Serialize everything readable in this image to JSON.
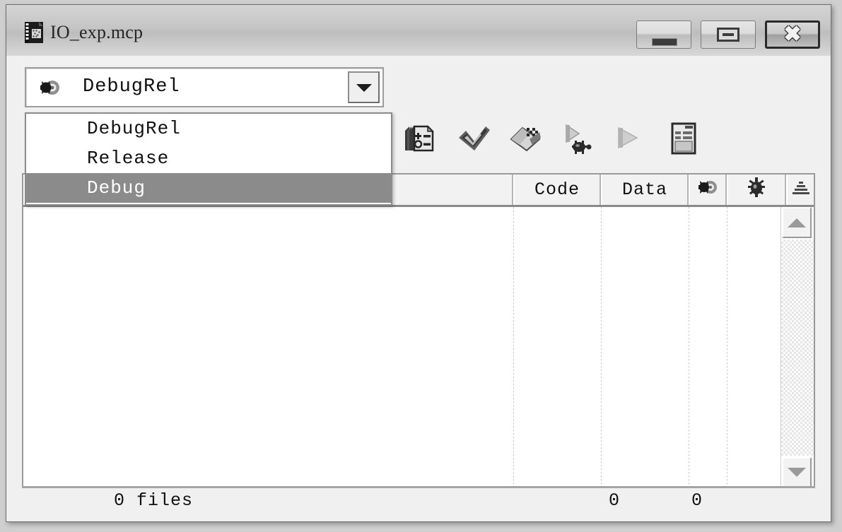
{
  "window": {
    "title": "IO_exp.mcp",
    "title_icon": "project-file-icon",
    "controls": [
      {
        "name": "minimize-button",
        "label": "–",
        "glyph": "minimize-icon"
      },
      {
        "name": "maximize-button",
        "label": "□",
        "glyph": "maximize-icon"
      },
      {
        "name": "close-button",
        "label": "✖",
        "glyph": "close-icon"
      }
    ]
  },
  "target_combo": {
    "icon": "build-target-icon",
    "value": "DebugRel",
    "expanded": true,
    "options": [
      {
        "label": "DebugRel",
        "selected": false
      },
      {
        "label": "Release",
        "selected": false
      },
      {
        "label": "Debug",
        "selected": true
      }
    ]
  },
  "toolbar": {
    "buttons": [
      {
        "name": "target-settings-button",
        "icon": "settings-list-icon",
        "enabled": true
      },
      {
        "name": "compile-button",
        "icon": "checkmark-icon",
        "enabled": true
      },
      {
        "name": "make-button",
        "icon": "make-build-icon",
        "enabled": true
      },
      {
        "name": "debug-button",
        "icon": "debug-bug-icon",
        "enabled": true
      },
      {
        "name": "run-button",
        "icon": "run-play-icon",
        "enabled": false
      },
      {
        "name": "project-inspector-button",
        "icon": "document-report-icon",
        "enabled": true
      }
    ]
  },
  "file_list": {
    "columns": [
      {
        "key": "file",
        "label": "",
        "icon": ""
      },
      {
        "key": "code",
        "label": "Code",
        "icon": ""
      },
      {
        "key": "data",
        "label": "Data",
        "icon": ""
      },
      {
        "key": "target",
        "label": "",
        "icon": "target-icon"
      },
      {
        "key": "debug",
        "label": "",
        "icon": "bug-icon"
      },
      {
        "key": "sort",
        "label": "",
        "icon": "sort-pyramid-icon"
      }
    ],
    "rows": []
  },
  "scrollbar": {
    "up_label": "▲",
    "down_label": "▼"
  },
  "status_bar": {
    "files": "0 files",
    "code_total": "0",
    "data_total": "0",
    "resize_grip": "resize-grip-icon"
  },
  "colors": {
    "window_bg": "#f0f0f0",
    "titlebar_top": "#d4d4d4",
    "titlebar_bottom": "#d8d8d8",
    "selection_bg": "#8b8b8b",
    "selection_fg": "#ffffff",
    "border": "#9a9a9a",
    "list_bg": "#ffffff",
    "text": "#111111"
  }
}
